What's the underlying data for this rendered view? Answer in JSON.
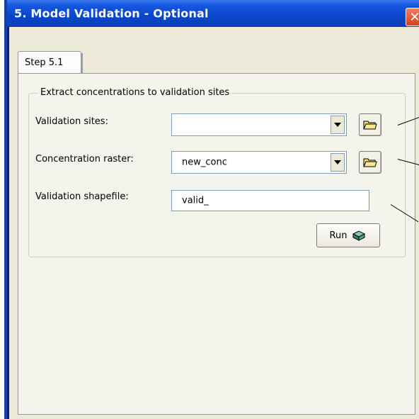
{
  "window": {
    "title": "5. Model Validation - Optional",
    "close_glyph": "✕"
  },
  "tabs": [
    {
      "label": "Step 5.1",
      "selected": true
    }
  ],
  "group": {
    "legend": "Extract concentrations to validation sites"
  },
  "fields": {
    "validation_sites": {
      "label": "Validation sites:",
      "value": ""
    },
    "concentration_raster": {
      "label": "Concentration raster:",
      "value": "new_conc"
    },
    "validation_shapefile": {
      "label": "Validation shapefile:",
      "value": "valid_"
    }
  },
  "buttons": {
    "run_label": "Run"
  },
  "icons": {
    "browse": "folder-open-icon",
    "run": "toolbox-icon",
    "dropdown": "chevron-down-icon"
  },
  "colors": {
    "titlebar": "#0a46c9",
    "panel": "#ece9d8",
    "close": "#d8401c"
  }
}
